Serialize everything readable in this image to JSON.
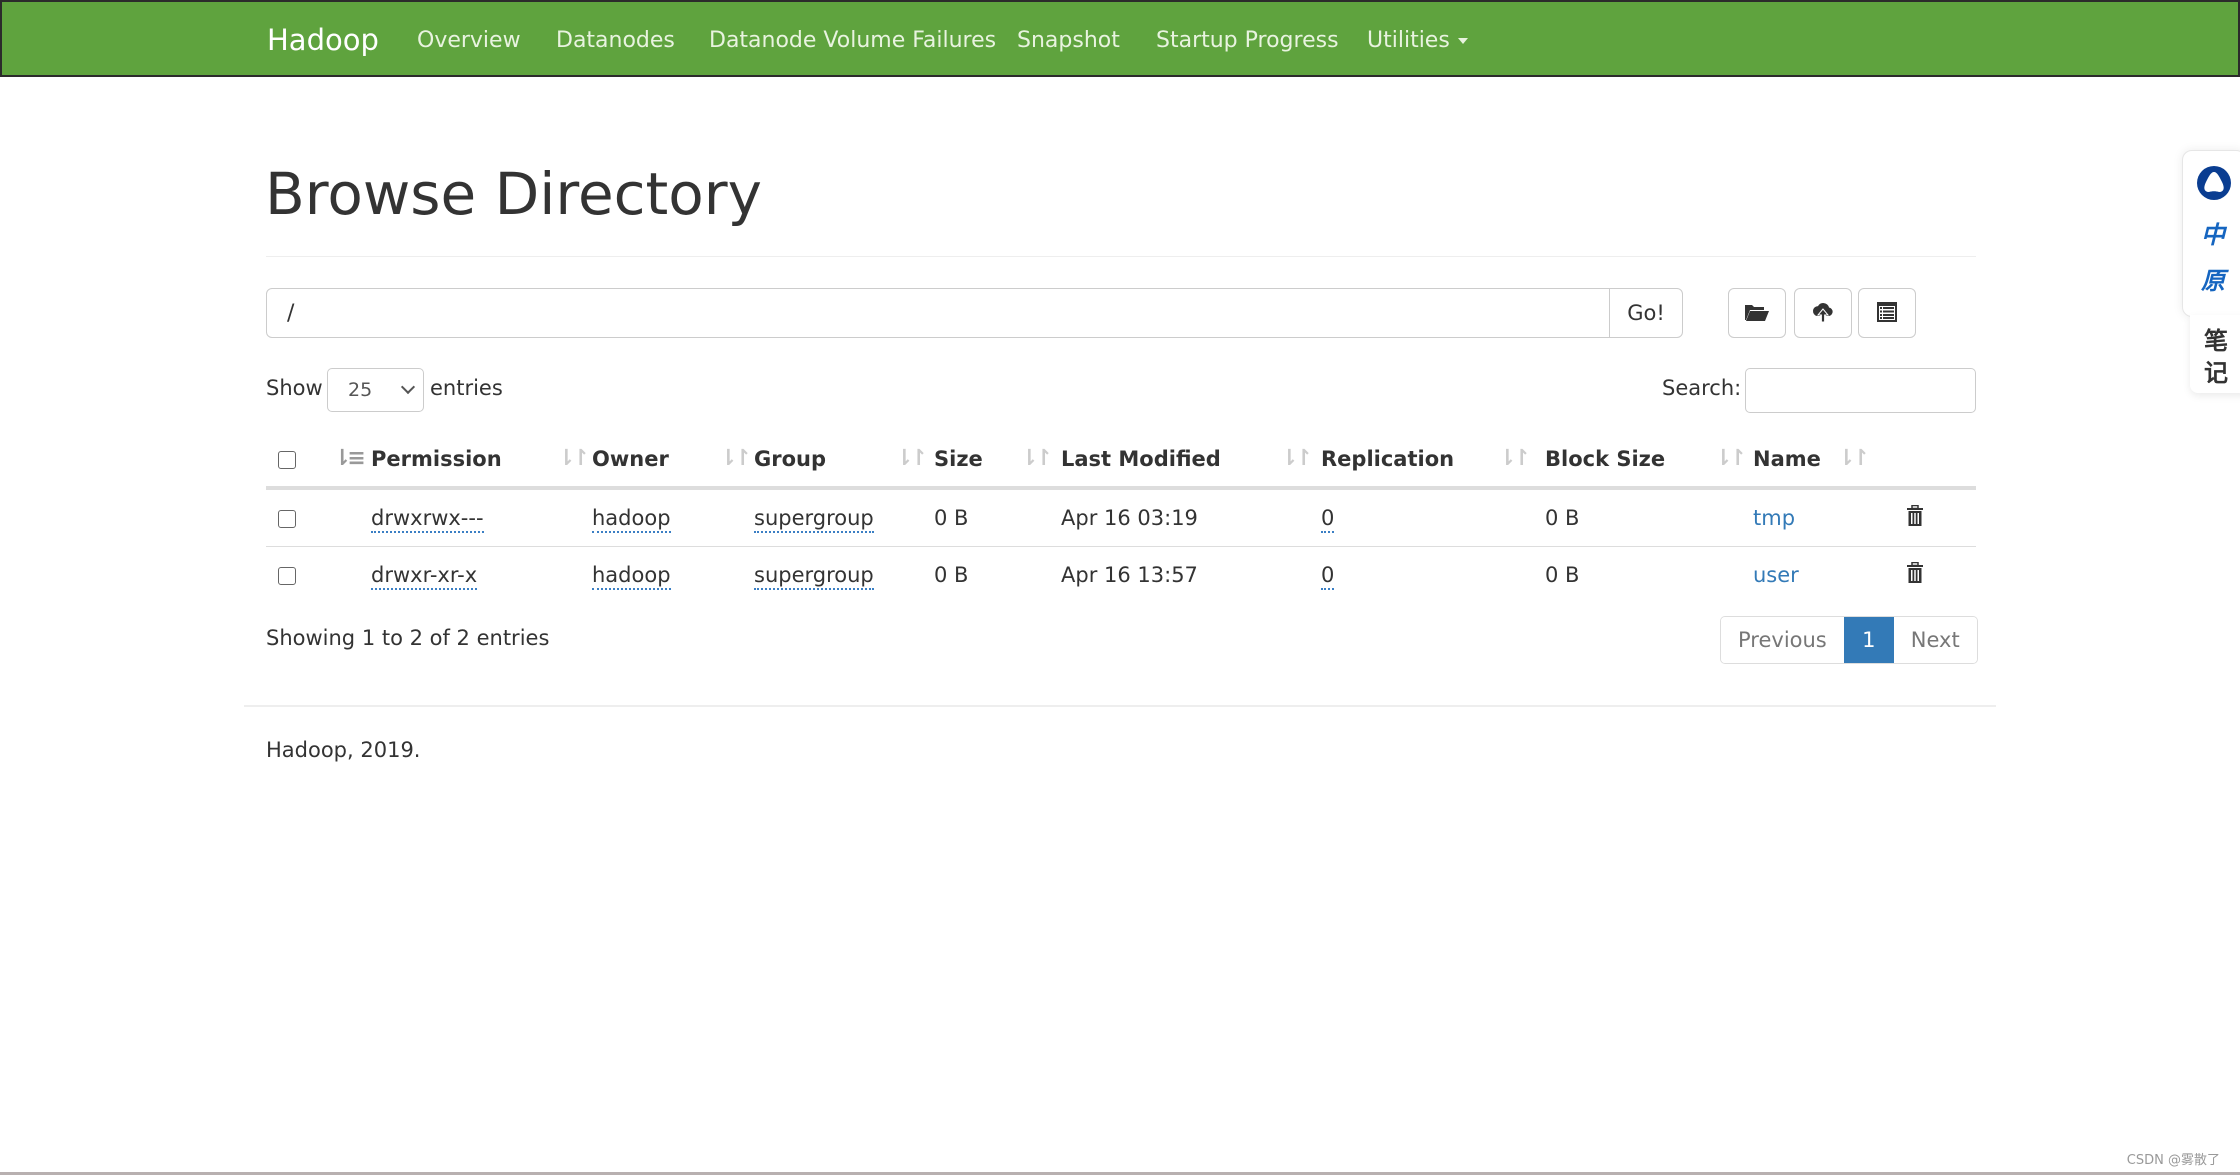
{
  "navbar": {
    "brand": "Hadoop",
    "items": [
      {
        "label": "Overview"
      },
      {
        "label": "Datanodes"
      },
      {
        "label": "Datanode Volume Failures"
      },
      {
        "label": "Snapshot"
      },
      {
        "label": "Startup Progress"
      },
      {
        "label": "Utilities",
        "has_dropdown": true
      }
    ],
    "color": "#5fa33e"
  },
  "page": {
    "title": "Browse Directory"
  },
  "path_bar": {
    "value": "/",
    "go_label": "Go!",
    "icons": [
      "folder-open-icon",
      "cloud-upload-icon",
      "list-alt-icon"
    ]
  },
  "table_controls": {
    "show_label": "Show",
    "page_length": "25",
    "entries_label": "entries",
    "search_label": "Search:",
    "search_value": ""
  },
  "table": {
    "columns": [
      "Permission",
      "Owner",
      "Group",
      "Size",
      "Last Modified",
      "Replication",
      "Block Size",
      "Name"
    ],
    "rows": [
      {
        "permission": "drwxrwx---",
        "owner": "hadoop",
        "group": "supergroup",
        "size": "0 B",
        "last_modified": "Apr 16 03:19",
        "replication": "0",
        "block_size": "0 B",
        "name": "tmp"
      },
      {
        "permission": "drwxr-xr-x",
        "owner": "hadoop",
        "group": "supergroup",
        "size": "0 B",
        "last_modified": "Apr 16 13:57",
        "replication": "0",
        "block_size": "0 B",
        "name": "user"
      }
    ],
    "link_color": "#337ab7"
  },
  "info": {
    "showing": "Showing 1 to 2 of 2 entries"
  },
  "pagination": {
    "previous": "Previous",
    "current": "1",
    "next": "Next",
    "active_color": "#337ab7"
  },
  "footer": {
    "text": "Hadoop, 2019."
  },
  "side_widget": {
    "chars_top": [
      "中",
      "原"
    ],
    "chars_bottom": [
      "笔",
      "记"
    ]
  },
  "watermark": "CSDN @雾散了"
}
